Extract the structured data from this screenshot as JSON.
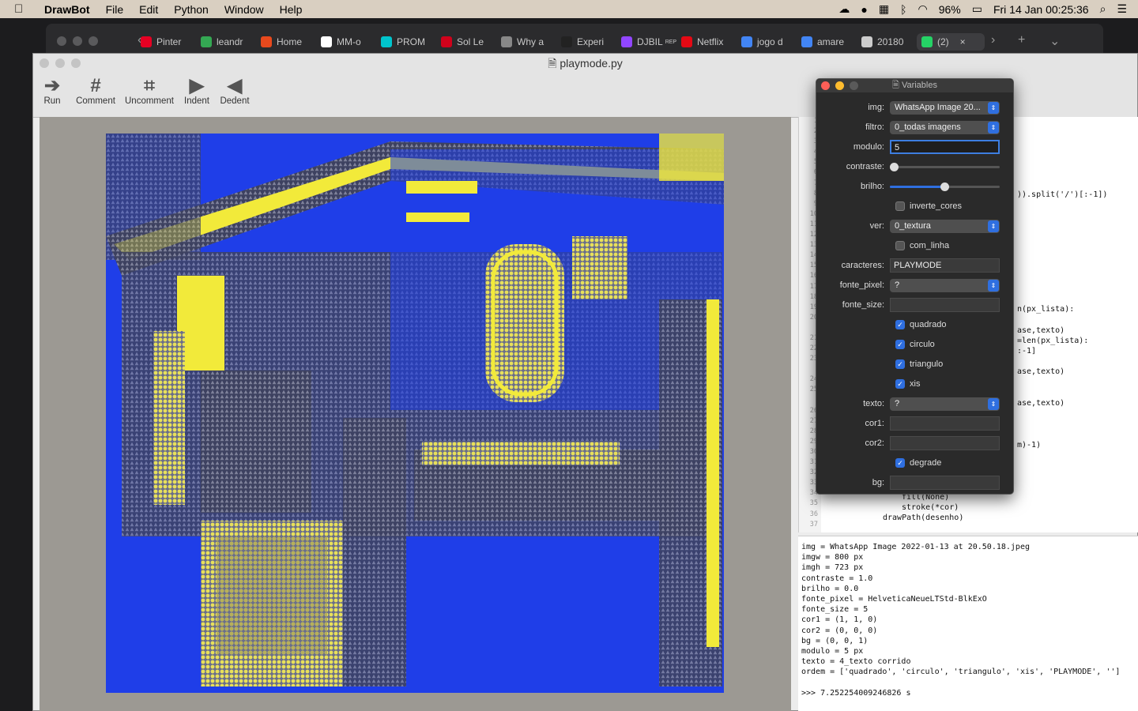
{
  "menubar": {
    "apple": "",
    "app": "DrawBot",
    "items": [
      "File",
      "Edit",
      "Python",
      "Window",
      "Help"
    ],
    "battery": "96%",
    "datetime": "Fri 14 Jan  00:25:36"
  },
  "browser": {
    "tabs": [
      "Pinter",
      "leandr",
      "Home",
      "MM-o",
      "PROM",
      "Sol Le",
      "Why a",
      "Experi",
      "DJBIL",
      "Netflix",
      "jogo d",
      "amare",
      "20180",
      "(2)"
    ],
    "tab_sub": "REPRO",
    "colors": [
      "#e60023",
      "#34a853",
      "#e8491d",
      "#ffffff",
      "#00c4cc",
      "#d0021b",
      "#888888",
      "#222222",
      "#9146ff",
      "#e50914",
      "#4285f4",
      "#4285f4",
      "#cccccc",
      "#25d366"
    ]
  },
  "window": {
    "title": "playmode.py"
  },
  "toolbar": {
    "run": "Run",
    "comment": "Comment",
    "uncomment": "Uncomment",
    "indent": "Indent",
    "dedent": "Dedent"
  },
  "code": {
    "gutter": [
      "1",
      "2",
      "3",
      "4",
      "5",
      "6",
      "7",
      "8",
      "9",
      "10",
      "11",
      "12",
      "13",
      "14",
      "15",
      "16",
      "17",
      "18",
      "19",
      "20",
      "",
      "21",
      "22",
      "23",
      "",
      "24",
      "25",
      "",
      "26",
      "27",
      "28",
      "29",
      "30",
      "31",
      "32",
      "33",
      "34",
      "35",
      "36",
      "37"
    ],
    "frag1": ")).split('/')[:-1])",
    "frag2": "n(px_lista):",
    "frag3": "ase,texto)",
    "frag4": "=len(px_lista):",
    "frag5": ":-1]",
    "frag6": "ase,texto)",
    "frag7": "ase,texto)",
    "frag8": "m)-1)",
    "line34": "fill(None)",
    "line35": "stroke(*cor)",
    "line36": "drawPath(desenho)"
  },
  "console": [
    "img = WhatsApp Image 2022-01-13 at 20.50.18.jpeg",
    "imgw = 800 px",
    "imgh = 723 px",
    "contraste = 1.0",
    "brilho = 0.0",
    "fonte_pixel = HelveticaNeueLTStd-BlkExO",
    "fonte_size = 5",
    "cor1 = (1, 1, 0)",
    "cor2 = (0, 0, 0)",
    "bg = (0, 0, 1)",
    "modulo = 5 px",
    "texto = 4_texto corrido",
    "ordem = ['quadrado', 'circulo', 'triangulo', 'xis', 'PLAYMODE', '']",
    "",
    ">>> 7.252254009246826 s"
  ],
  "variables": {
    "title": "Variables",
    "img_label": "img:",
    "img_value": "WhatsApp Image 20...",
    "filtro_label": "filtro:",
    "filtro_value": "0_todas imagens",
    "modulo_label": "modulo:",
    "modulo_value": "5",
    "contraste_label": "contraste:",
    "contraste_level": 0.0,
    "brilho_label": "brilho:",
    "brilho_level": 0.5,
    "inverte_label": "inverte_cores",
    "ver_label": "ver:",
    "ver_value": "0_textura",
    "com_linha_label": "com_linha",
    "caracteres_label": "caracteres:",
    "caracteres_value": "PLAYMODE",
    "fonte_pixel_label": "fonte_pixel:",
    "fonte_pixel_value": "?",
    "fonte_size_label": "fonte_size:",
    "quadrado_label": "quadrado",
    "circulo_label": "circulo",
    "triangulo_label": "triangulo",
    "xis_label": "xis",
    "texto_label": "texto:",
    "texto_value": "?",
    "cor1_label": "cor1:",
    "cor2_label": "cor2:",
    "degrade_label": "degrade",
    "bg_label": "bg:"
  },
  "image": {
    "palette": {
      "bg": "#1f3ee8",
      "yellow": "#f2ea3a",
      "gray": "#6b6f8a",
      "dark": "#33364d",
      "olive": "#b7b05a"
    }
  }
}
